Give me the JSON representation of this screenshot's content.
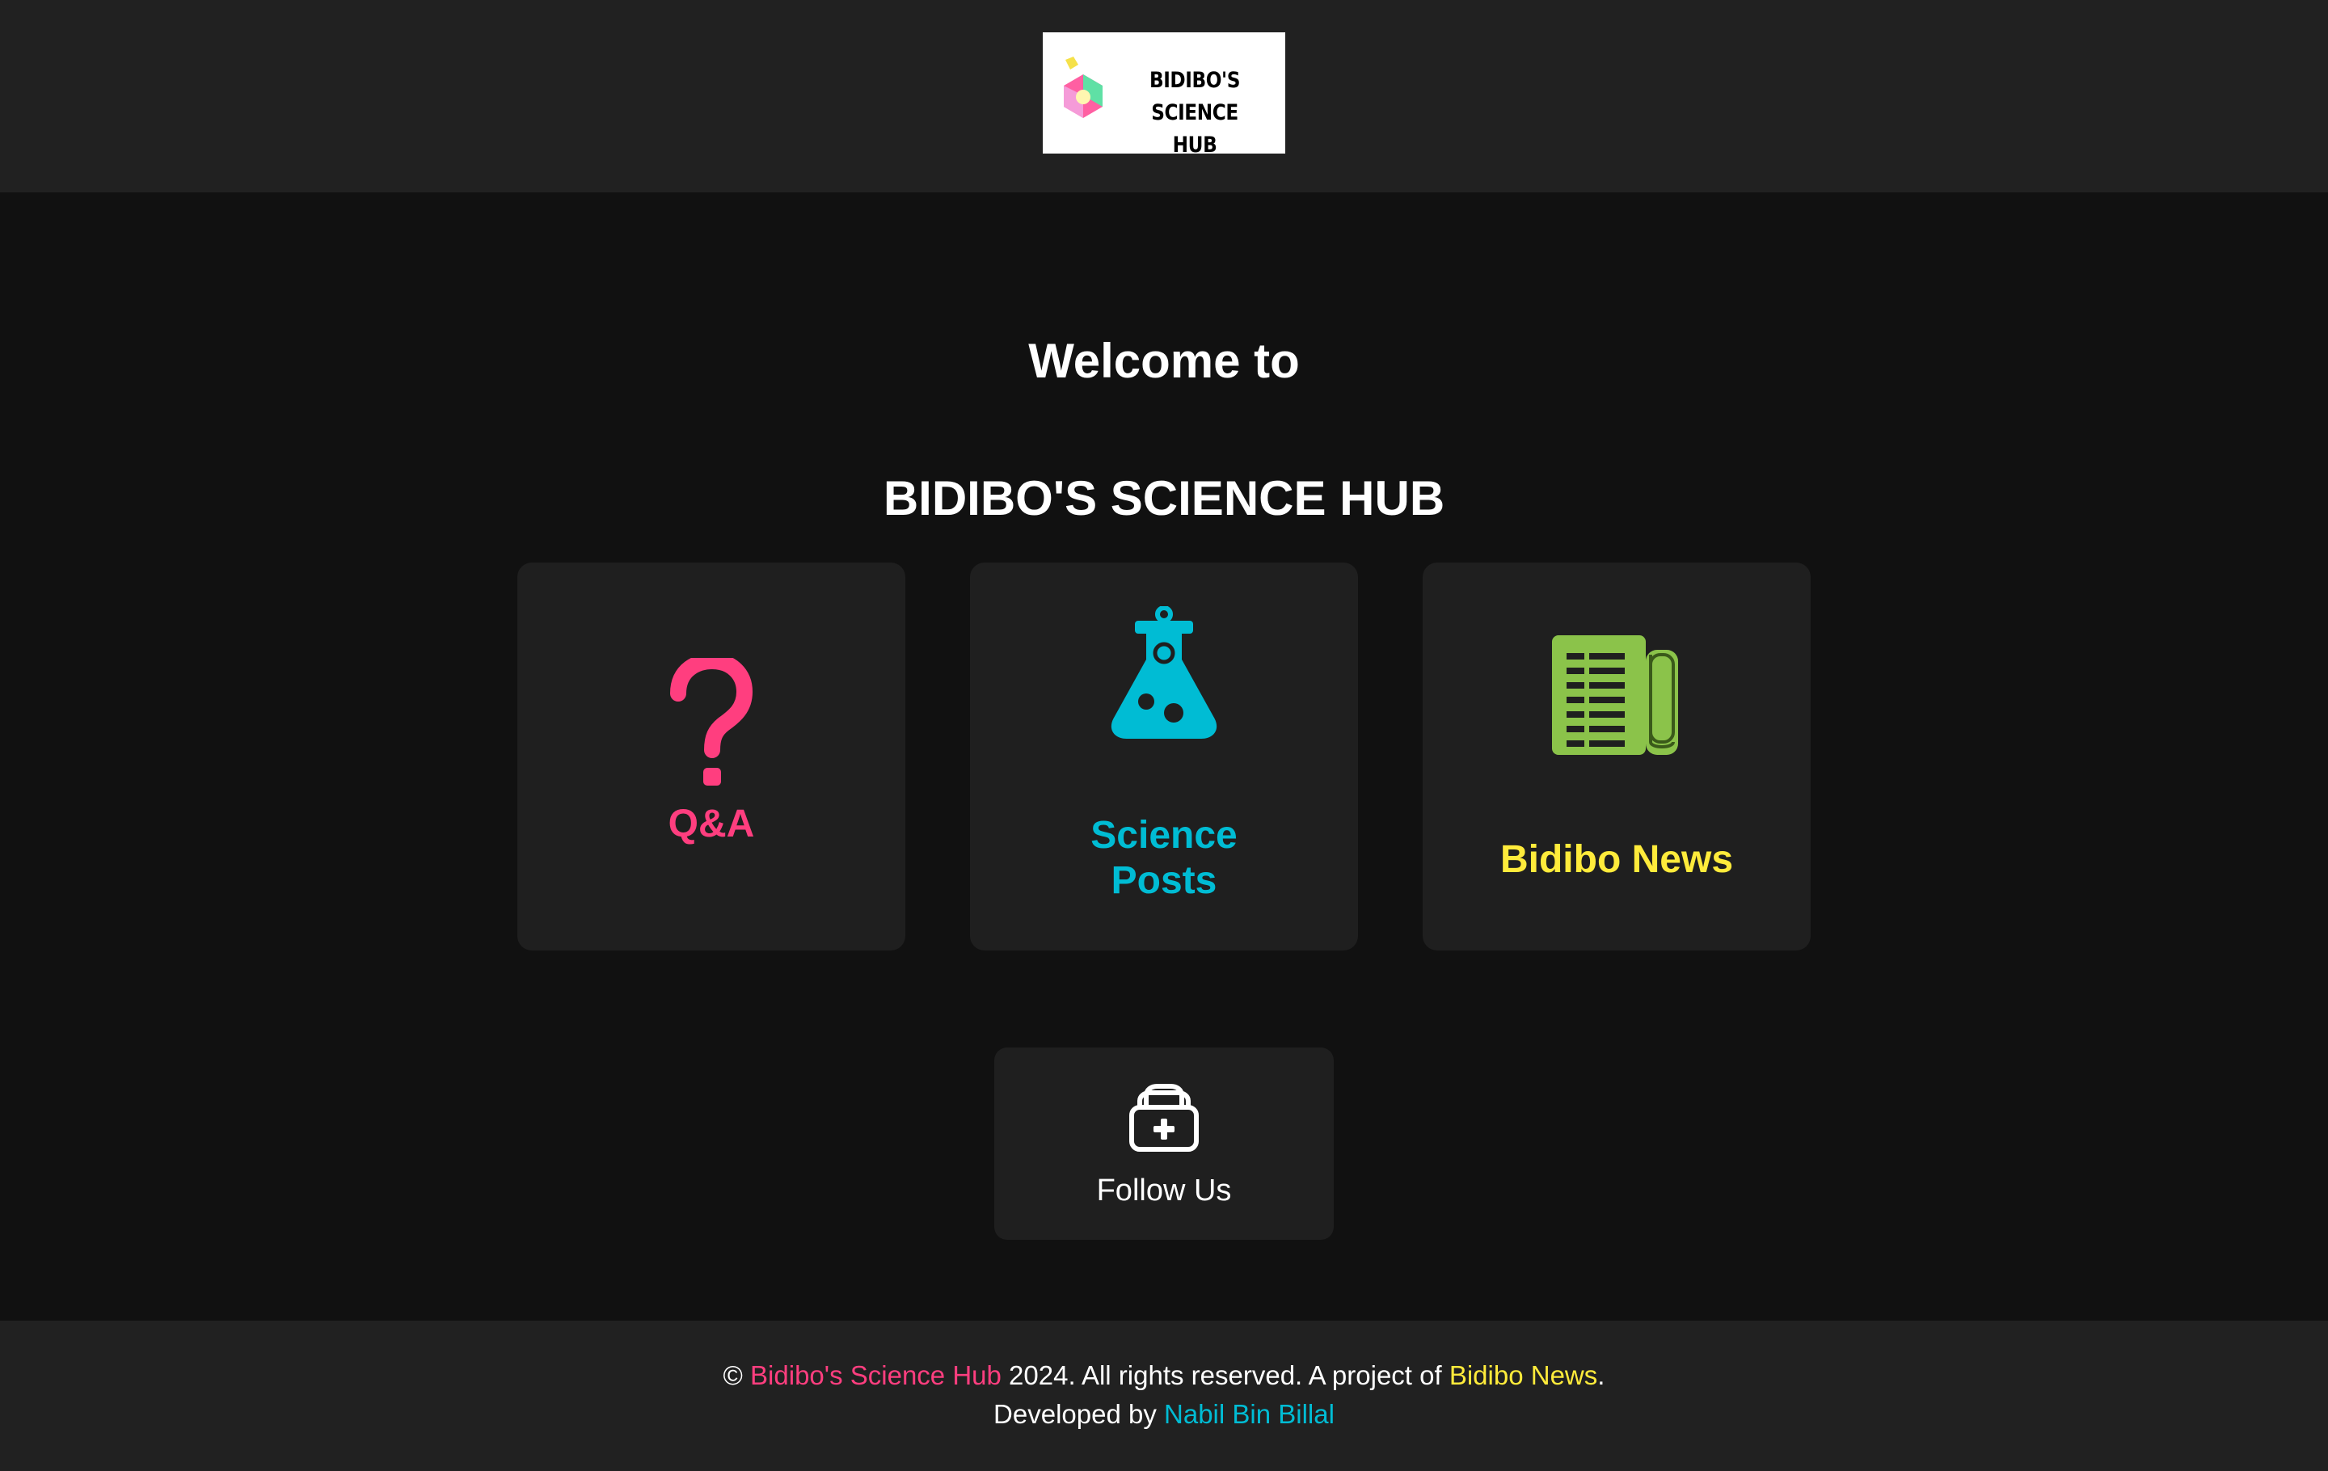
{
  "header": {
    "logo_alt": "BIDIBO'S SCIENCE HUB",
    "logo_line1": "BIDIBO'S SCIENCE",
    "logo_line2": "HUB"
  },
  "hero": {
    "welcome": "Welcome to",
    "title": "BIDIBO'S SCIENCE HUB"
  },
  "cards": [
    {
      "label": "Q&A",
      "icon": "question-mark-icon",
      "color": "#ff3e7f"
    },
    {
      "label_line1": "Science",
      "label_line2": "Posts",
      "icon": "flask-icon",
      "color": "#00bcd4"
    },
    {
      "label": "Bidibo News",
      "icon": "newspaper-icon",
      "color": "#ffeb3b",
      "icon_color": "#8bc34a"
    }
  ],
  "follow": {
    "label": "Follow Us",
    "icon": "medical-bag-icon"
  },
  "footer": {
    "copyright_symbol": "©",
    "site_name": "Bidibo's Science Hub",
    "rights_text": "2024. All rights reserved. A project of",
    "project_link": "Bidibo News",
    "period": ".",
    "developed_by": "Developed by",
    "developer": "Nabil Bin Billal"
  },
  "colors": {
    "page_bg": "#111111",
    "header_bg": "#212121",
    "card_bg": "#1f1f1f",
    "pink": "#ff3e7f",
    "cyan": "#00bcd4",
    "yellow": "#ffeb3b",
    "green": "#8bc34a"
  }
}
